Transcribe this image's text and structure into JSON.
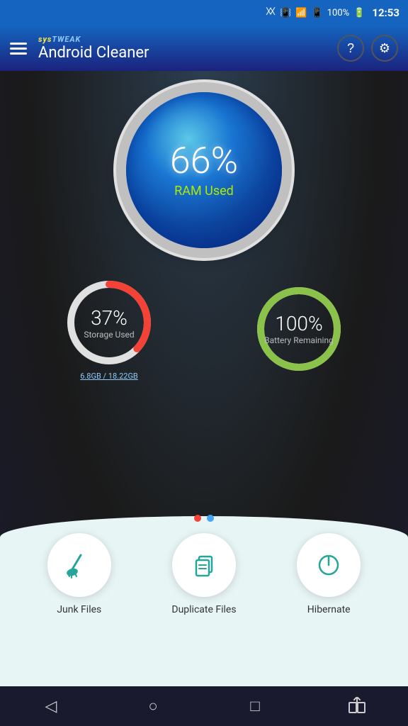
{
  "statusBar": {
    "battery": "100%",
    "time": "12:53",
    "icons": [
      "bluetooth",
      "vibrate",
      "wifi",
      "sim"
    ]
  },
  "header": {
    "brandTop": "sys",
    "brandTopHighlight": "TWEAK",
    "title": "Android Cleaner",
    "helpLabel": "?",
    "settingsLabel": "⚙"
  },
  "ram": {
    "percentage": "66%",
    "label": "RAM Used"
  },
  "storage": {
    "percentage": "37%",
    "label": "Storage Used",
    "detail": "6.8GB / 18.22GB",
    "ringColor": "#f44336",
    "ringBg": "#e0e0e0"
  },
  "battery": {
    "percentage": "100%",
    "label": "Battery Remaining",
    "ringColor": "#8bc34a",
    "ringBg": "#e0e0e0"
  },
  "actions": [
    {
      "id": "junk-files",
      "label": "Junk Files",
      "icon": "broom"
    },
    {
      "id": "duplicate-files",
      "label": "Duplicate Files",
      "icon": "copy"
    },
    {
      "id": "hibernate",
      "label": "Hibernate",
      "icon": "power"
    }
  ],
  "dots": {
    "active": 0,
    "count": 2
  },
  "navBar": {
    "back": "◁",
    "home": "○",
    "recent": "□",
    "share": "↺"
  }
}
